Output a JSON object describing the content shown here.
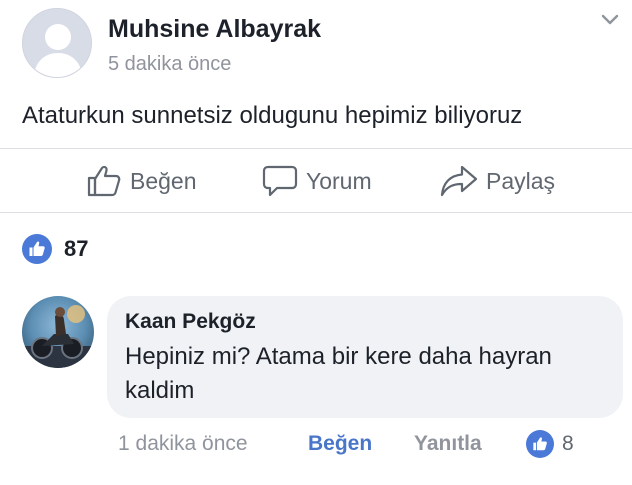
{
  "post": {
    "author_name": "Muhsine Albayrak",
    "time": "5 dakika önce",
    "text": "Ataturkun sunnetsiz oldugunu hepimiz biliyoruz"
  },
  "actions": {
    "like_label": "Beğen",
    "comment_label": "Yorum",
    "share_label": "Paylaş"
  },
  "reactions": {
    "count": "87"
  },
  "comment": {
    "author_name": "Kaan Pekgöz",
    "text": "Hepiniz mi? Atama bir kere daha hayran kaldim",
    "time": "1 dakika önce",
    "like_label": "Beğen",
    "reply_label": "Yanıtla",
    "reaction_count": "8"
  },
  "icons": {
    "menu": "chevron-down-icon",
    "like": "thumbs-up-icon",
    "comment": "speech-bubble-icon",
    "share": "share-arrow-icon"
  },
  "colors": {
    "like_blue": "#4a79d8",
    "link_blue": "#4a76c9",
    "muted_gray": "#90949c",
    "bubble_bg": "#f0f2f5"
  }
}
